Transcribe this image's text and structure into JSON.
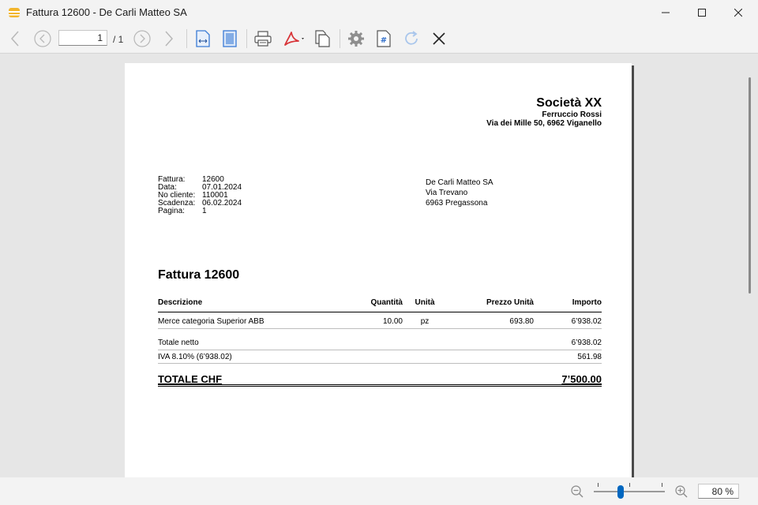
{
  "window": {
    "title": "Fattura 12600 - De Carli Matteo SA",
    "controls": [
      "minimize-icon",
      "maximize-icon",
      "close-icon"
    ]
  },
  "toolbar": {
    "page_current": "1",
    "page_total": "/ 1",
    "icons": [
      "back-arrow-icon",
      "prev-page-icon",
      "next-page-icon",
      "forward-arrow-icon",
      "fit-width-icon",
      "fit-page-icon",
      "print-icon",
      "pdf-icon",
      "copy-icon",
      "settings-icon",
      "document-number-icon",
      "refresh-icon",
      "close-icon"
    ]
  },
  "invoice": {
    "company": {
      "name": "Società XX",
      "contact": "Ferruccio Rossi",
      "address": "Via dei Mille 50, 6962 Viganello"
    },
    "info": [
      {
        "label": "Fattura:",
        "value": "12600"
      },
      {
        "label": "Data:",
        "value": "07.01.2024"
      },
      {
        "label": "No cliente:",
        "value": "110001"
      },
      {
        "label": "Scadenza:",
        "value": "06.02.2024"
      },
      {
        "label": "Pagina:",
        "value": "1"
      }
    ],
    "recipient": [
      "De Carli Matteo SA",
      "Via Trevano",
      "6963 Pregassona"
    ],
    "title": "Fattura 12600",
    "columns": [
      "Descrizione",
      "Quantità",
      "Unità",
      "Prezzo Unità",
      "Importo"
    ],
    "items": [
      {
        "description": "Merce categoria Superior ABB",
        "quantity": "10.00",
        "unit": "pz",
        "price": "693.80",
        "amount": "6’938.02"
      }
    ],
    "net_label": "Totale netto",
    "net_amount": "6’938.02",
    "vat_label": "IVA 8.10% (6’938.02)",
    "vat_amount": "561.98",
    "total_label": "TOTALE CHF",
    "total_amount": "7’500.00"
  },
  "statusbar": {
    "zoom": "80 %",
    "zoom_fraction": 0.38
  },
  "colors": {
    "accent": "#0067c0",
    "pdf_red": "#d8363a",
    "tool_blue": "#3a7bd5"
  }
}
